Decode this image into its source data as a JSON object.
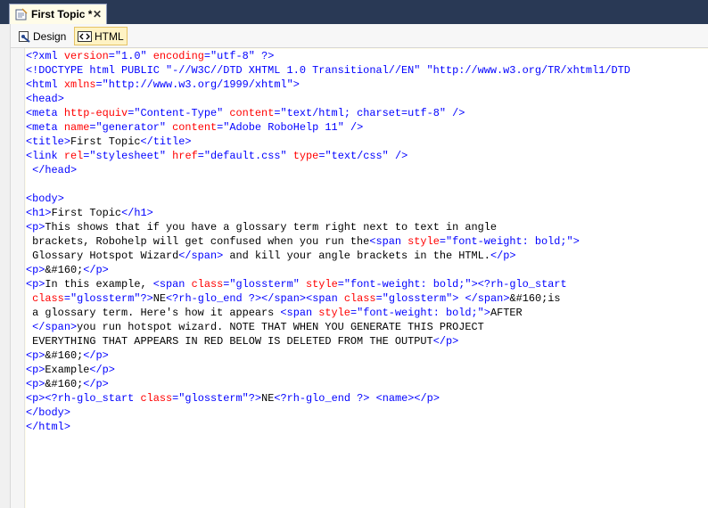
{
  "tab": {
    "title": "First Topic *",
    "close_glyph": "✕"
  },
  "toolbar": {
    "design_label": "Design",
    "html_label": "HTML",
    "active_view": "HTML"
  },
  "icons": {
    "tab_icon": "topic-icon",
    "design_icon": "design-view-icon",
    "html_icon": "html-view-icon"
  },
  "colors": {
    "tag": "#0000ff",
    "attribute": "#ff0000",
    "value": "#0000ff",
    "text": "#000000",
    "tab_background": "#fffce8",
    "frame": "#293955"
  },
  "code_lines": [
    "<?xml version=\"1.0\" encoding=\"utf-8\" ?>",
    "<!DOCTYPE html PUBLIC \"-//W3C//DTD XHTML 1.0 Transitional//EN\" \"http://www.w3.org/TR/xhtml1/DTD",
    "<html xmlns=\"http://www.w3.org/1999/xhtml\">",
    "<head>",
    "<meta http-equiv=\"Content-Type\" content=\"text/html; charset=utf-8\" />",
    "<meta name=\"generator\" content=\"Adobe RoboHelp 11\" />",
    "<title>First Topic</title>",
    "<link rel=\"stylesheet\" href=\"default.css\" type=\"text/css\" />",
    " </head>",
    "",
    "<body>",
    "<h1>First Topic</h1>",
    "<p>This shows that if you have a glossary term right next to text in angle",
    " brackets, Robohelp will get confused when you run the<span style=\"font-weight: bold;\">",
    " Glossary Hotspot Wizard</span> and kill your angle brackets in the HTML.</p>",
    "<p>&#160;</p>",
    "<p>In this example, <span class=\"glossterm\" style=\"font-weight: bold;\"><?rh-glo_start",
    " class=\"glossterm\"?>NE<?rh-glo_end ?></span><span class=\"glossterm\"> </span>&#160;is",
    " a glossary term. Here's how it appears <span style=\"font-weight: bold;\">AFTER",
    " </span>you run hotspot wizard. NOTE THAT WHEN YOU GENERATE THIS PROJECT",
    " EVERYTHING THAT APPEARS IN RED BELOW IS DELETED FROM THE OUTPUT</p>",
    "<p>&#160;</p>",
    "<p>Example</p>",
    "<p>&#160;</p>",
    "<p><?rh-glo_start class=\"glossterm\"?>NE<?rh-glo_end ?> <name></p>",
    "</body>",
    "</html>"
  ]
}
